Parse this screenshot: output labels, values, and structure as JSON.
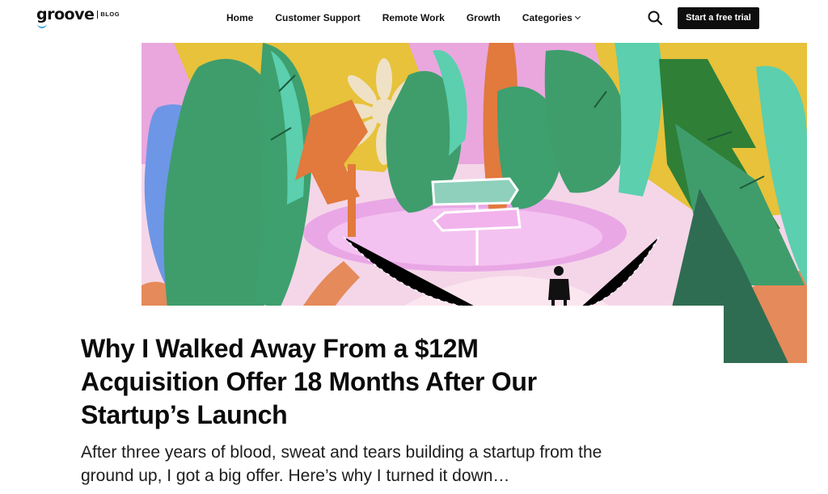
{
  "brand": {
    "name": "groove",
    "section": "BLOG"
  },
  "nav": {
    "items": [
      {
        "label": "Home"
      },
      {
        "label": "Customer Support"
      },
      {
        "label": "Remote Work"
      },
      {
        "label": "Growth"
      },
      {
        "label": "Categories"
      }
    ],
    "cta_label": "Start a free trial",
    "search_icon": "search-icon"
  },
  "article": {
    "title": "Why I Walked Away From a $12M Acquisition Offer 18 Months After Our Startup’s Launch",
    "excerpt": "After three years of blood, sweat and tears building a startup from the ground up, I got a big offer. Here’s why I turned it down…"
  },
  "colors": {
    "accent_blue": "#4aa3df",
    "button_bg": "#0e0e0e",
    "text": "#111111"
  }
}
